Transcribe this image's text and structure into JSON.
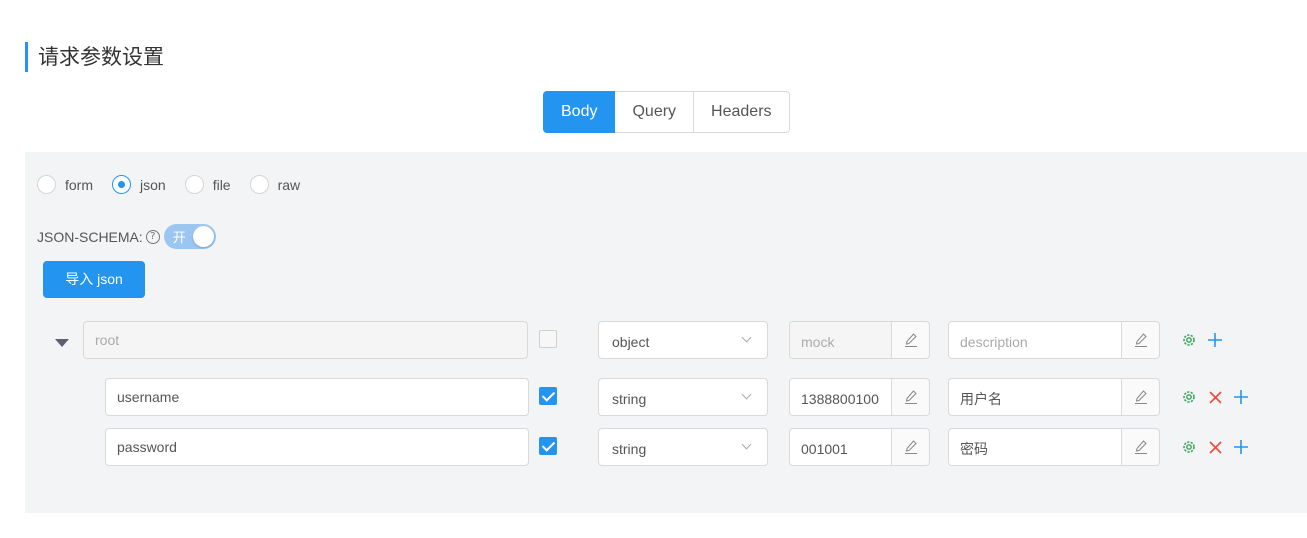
{
  "section_title": "请求参数设置",
  "tabs": [
    {
      "label": "Body",
      "active": true
    },
    {
      "label": "Query",
      "active": false
    },
    {
      "label": "Headers",
      "active": false
    }
  ],
  "body_types": [
    {
      "label": "form",
      "checked": false
    },
    {
      "label": "json",
      "checked": true
    },
    {
      "label": "file",
      "checked": false
    },
    {
      "label": "raw",
      "checked": false
    }
  ],
  "schema": {
    "label": "JSON-SCHEMA:",
    "help_icon": "question-circle-icon",
    "switch_text": "开",
    "switch_on": true
  },
  "import_button": "导入 json",
  "rows": {
    "root": {
      "name_placeholder": "root",
      "type": "object",
      "mock_placeholder": "mock",
      "description_placeholder": "description"
    },
    "username": {
      "name": "username",
      "required": true,
      "type": "string",
      "mock": "1388800100",
      "description": "用户名"
    },
    "password": {
      "name": "password",
      "required": true,
      "type": "string",
      "mock": "001001",
      "description": "密码"
    }
  },
  "colors": {
    "primary": "#2395f1",
    "settings_icon": "#3aa35b",
    "delete_icon": "#f5483b",
    "add_icon": "#2395f1"
  }
}
